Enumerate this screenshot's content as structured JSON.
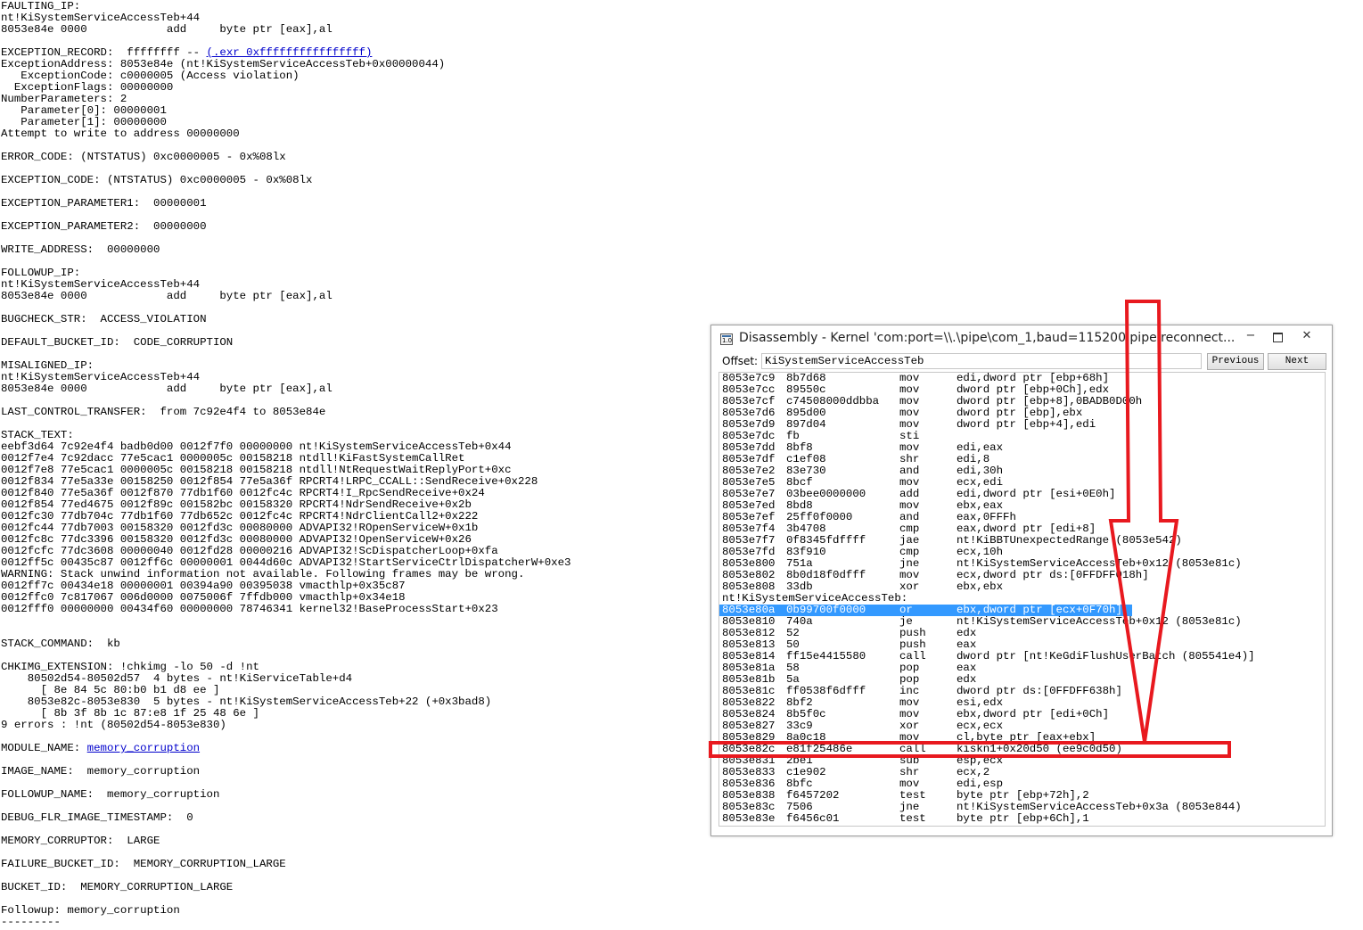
{
  "left_log": {
    "lines": [
      "FAULTING_IP:",
      "nt!KiSystemServiceAccessTeb+44",
      "8053e84e 0000            add     byte ptr [eax],al",
      "",
      "EXCEPTION_RECORD:  ffffffff -- ",
      "ExceptionAddress: 8053e84e (nt!KiSystemServiceAccessTeb+0x00000044)",
      "   ExceptionCode: c0000005 (Access violation)",
      "  ExceptionFlags: 00000000",
      "NumberParameters: 2",
      "   Parameter[0]: 00000001",
      "   Parameter[1]: 00000000",
      "Attempt to write to address 00000000",
      "",
      "ERROR_CODE: (NTSTATUS) 0xc0000005 - 0x%08lx",
      "",
      "EXCEPTION_CODE: (NTSTATUS) 0xc0000005 - 0x%08lx",
      "",
      "EXCEPTION_PARAMETER1:  00000001",
      "",
      "EXCEPTION_PARAMETER2:  00000000",
      "",
      "WRITE_ADDRESS:  00000000",
      "",
      "FOLLOWUP_IP:",
      "nt!KiSystemServiceAccessTeb+44",
      "8053e84e 0000            add     byte ptr [eax],al",
      "",
      "BUGCHECK_STR:  ACCESS_VIOLATION",
      "",
      "DEFAULT_BUCKET_ID:  CODE_CORRUPTION",
      "",
      "MISALIGNED_IP:",
      "nt!KiSystemServiceAccessTeb+44",
      "8053e84e 0000            add     byte ptr [eax],al",
      "",
      "LAST_CONTROL_TRANSFER:  from 7c92e4f4 to 8053e84e",
      "",
      "STACK_TEXT:",
      "eebf3d64 7c92e4f4 badb0d00 0012f7f0 00000000 nt!KiSystemServiceAccessTeb+0x44",
      "0012f7e4 7c92dacc 77e5cac1 0000005c 00158218 ntdll!KiFastSystemCallRet",
      "0012f7e8 77e5cac1 0000005c 00158218 00158218 ntdll!NtRequestWaitReplyPort+0xc",
      "0012f834 77e5a33e 00158250 0012f854 77e5a36f RPCRT4!LRPC_CCALL::SendReceive+0x228",
      "0012f840 77e5a36f 0012f870 77db1f60 0012fc4c RPCRT4!I_RpcSendReceive+0x24",
      "0012f854 77ed4675 0012f89c 001582bc 00158320 RPCRT4!NdrSendReceive+0x2b",
      "0012fc30 77db704c 77db1f60 77db652c 0012fc4c RPCRT4!NdrClientCall2+0x222",
      "0012fc44 77db7003 00158320 0012fd3c 00080000 ADVAPI32!ROpenServiceW+0x1b",
      "0012fc8c 77dc3396 00158320 0012fd3c 00080000 ADVAPI32!OpenServiceW+0x26",
      "0012fcfc 77dc3608 00000040 0012fd28 00000216 ADVAPI32!ScDispatcherLoop+0xfa",
      "0012ff5c 00435c87 0012ff6c 00000001 0044d60c ADVAPI32!StartServiceCtrlDispatcherW+0xe3",
      "WARNING: Stack unwind information not available. Following frames may be wrong.",
      "0012ff7c 00434e18 00000001 00394a90 00395038 vmacthlp+0x35c87",
      "0012ffc0 7c817067 006d0000 0075006f 7ffdb000 vmacthlp+0x34e18",
      "0012fff0 00000000 00434f60 00000000 78746341 kernel32!BaseProcessStart+0x23",
      "",
      "",
      "STACK_COMMAND:  kb",
      "",
      "CHKIMG_EXTENSION: !chkimg -lo 50 -d !nt",
      "    80502d54-80502d57  4 bytes - nt!KiServiceTable+d4",
      "      [ 8e 84 5c 80:b0 b1 d8 ee ]",
      "    8053e82c-8053e830  5 bytes - nt!KiSystemServiceAccessTeb+22 (+0x3bad8)",
      "      [ 8b 3f 8b 1c 87:e8 1f 25 48 6e ]",
      "9 errors : !nt (80502d54-8053e830)",
      "",
      "MODULE_NAME: ",
      "",
      "IMAGE_NAME:  memory_corruption",
      "",
      "FOLLOWUP_NAME:  memory_corruption",
      "",
      "DEBUG_FLR_IMAGE_TIMESTAMP:  0",
      "",
      "MEMORY_CORRUPTOR:  LARGE",
      "",
      "FAILURE_BUCKET_ID:  MEMORY_CORRUPTION_LARGE",
      "",
      "BUCKET_ID:  MEMORY_CORRUPTION_LARGE",
      "",
      "Followup: memory_corruption",
      "---------"
    ],
    "exr_link": "(.exr 0xffffffffffffffff)",
    "module_link": "memory_corruption"
  },
  "window": {
    "title": "Disassembly - Kernel 'com:port=\\\\.\\pipe\\com_1,baud=115200,pipe,reconnect...",
    "min_glyph": "−",
    "close_glyph": "✕",
    "offset_label": "Offset:",
    "offset_value": "KiSystemServiceAccessTeb",
    "prev_label": "Previous",
    "next_label": "Next"
  },
  "disassembly": [
    {
      "addr": "8053e7c9",
      "bytes": "8b7d68",
      "mn": "mov",
      "op": "edi,dword ptr [ebp+68h]"
    },
    {
      "addr": "8053e7cc",
      "bytes": "89550c",
      "mn": "mov",
      "op": "dword ptr [ebp+0Ch],edx"
    },
    {
      "addr": "8053e7cf",
      "bytes": "c74508000ddbba",
      "mn": "mov",
      "op": "dword ptr [ebp+8],0BADB0D00h"
    },
    {
      "addr": "8053e7d6",
      "bytes": "895d00",
      "mn": "mov",
      "op": "dword ptr [ebp],ebx"
    },
    {
      "addr": "8053e7d9",
      "bytes": "897d04",
      "mn": "mov",
      "op": "dword ptr [ebp+4],edi"
    },
    {
      "addr": "8053e7dc",
      "bytes": "fb",
      "mn": "sti",
      "op": ""
    },
    {
      "addr": "8053e7dd",
      "bytes": "8bf8",
      "mn": "mov",
      "op": "edi,eax"
    },
    {
      "addr": "8053e7df",
      "bytes": "c1ef08",
      "mn": "shr",
      "op": "edi,8"
    },
    {
      "addr": "8053e7e2",
      "bytes": "83e730",
      "mn": "and",
      "op": "edi,30h"
    },
    {
      "addr": "8053e7e5",
      "bytes": "8bcf",
      "mn": "mov",
      "op": "ecx,edi"
    },
    {
      "addr": "8053e7e7",
      "bytes": "03bee0000000",
      "mn": "add",
      "op": "edi,dword ptr [esi+0E0h]"
    },
    {
      "addr": "8053e7ed",
      "bytes": "8bd8",
      "mn": "mov",
      "op": "ebx,eax"
    },
    {
      "addr": "8053e7ef",
      "bytes": "25ff0f0000",
      "mn": "and",
      "op": "eax,0FFFh"
    },
    {
      "addr": "8053e7f4",
      "bytes": "3b4708",
      "mn": "cmp",
      "op": "eax,dword ptr [edi+8]"
    },
    {
      "addr": "8053e7f7",
      "bytes": "0f8345fdffff",
      "mn": "jae",
      "op": "nt!KiBBTUnexpectedRange (8053e542)"
    },
    {
      "addr": "8053e7fd",
      "bytes": "83f910",
      "mn": "cmp",
      "op": "ecx,10h"
    },
    {
      "addr": "8053e800",
      "bytes": "751a",
      "mn": "jne",
      "op": "nt!KiSystemServiceAccessTeb+0x12 (8053e81c)"
    },
    {
      "addr": "8053e802",
      "bytes": "8b0d18f0dfff",
      "mn": "mov",
      "op": "ecx,dword ptr ds:[0FFDFF018h]"
    },
    {
      "addr": "8053e808",
      "bytes": "33db",
      "mn": "xor",
      "op": "ebx,ebx"
    },
    {
      "label": "nt!KiSystemServiceAccessTeb:"
    },
    {
      "addr": "8053e80a",
      "bytes": "0b99700f0000",
      "mn": "or",
      "op": "ebx,dword ptr [ecx+0F70h]",
      "selected": true
    },
    {
      "addr": "8053e810",
      "bytes": "740a",
      "mn": "je",
      "op": "nt!KiSystemServiceAccessTeb+0x12 (8053e81c)"
    },
    {
      "addr": "8053e812",
      "bytes": "52",
      "mn": "push",
      "op": "edx"
    },
    {
      "addr": "8053e813",
      "bytes": "50",
      "mn": "push",
      "op": "eax"
    },
    {
      "addr": "8053e814",
      "bytes": "ff15e4415580",
      "mn": "call",
      "op": "dword ptr [nt!KeGdiFlushUserBatch (805541e4)]"
    },
    {
      "addr": "8053e81a",
      "bytes": "58",
      "mn": "pop",
      "op": "eax"
    },
    {
      "addr": "8053e81b",
      "bytes": "5a",
      "mn": "pop",
      "op": "edx"
    },
    {
      "addr": "8053e81c",
      "bytes": "ff0538f6dfff",
      "mn": "inc",
      "op": "dword ptr ds:[0FFDFF638h]"
    },
    {
      "addr": "8053e822",
      "bytes": "8bf2",
      "mn": "mov",
      "op": "esi,edx"
    },
    {
      "addr": "8053e824",
      "bytes": "8b5f0c",
      "mn": "mov",
      "op": "ebx,dword ptr [edi+0Ch]"
    },
    {
      "addr": "8053e827",
      "bytes": "33c9",
      "mn": "xor",
      "op": "ecx,ecx"
    },
    {
      "addr": "8053e829",
      "bytes": "8a0c18",
      "mn": "mov",
      "op": "cl,byte ptr [eax+ebx]"
    },
    {
      "addr": "8053e82c",
      "bytes": "e81f25486e",
      "mn": "call",
      "op": "kiskn1+0x20d50 (ee9c0d50)"
    },
    {
      "addr": "8053e831",
      "bytes": "2be1",
      "mn": "sub",
      "op": "esp,ecx"
    },
    {
      "addr": "8053e833",
      "bytes": "c1e902",
      "mn": "shr",
      "op": "ecx,2"
    },
    {
      "addr": "8053e836",
      "bytes": "8bfc",
      "mn": "mov",
      "op": "edi,esp"
    },
    {
      "addr": "8053e838",
      "bytes": "f6457202",
      "mn": "test",
      "op": "byte ptr [ebp+72h],2"
    },
    {
      "addr": "8053e83c",
      "bytes": "7506",
      "mn": "jne",
      "op": "nt!KiSystemServiceAccessTeb+0x3a (8053e844)"
    },
    {
      "addr": "8053e83e",
      "bytes": "f6456c01",
      "mn": "test",
      "op": "byte ptr [ebp+6Ch],1"
    }
  ],
  "annotation": {
    "color": "#e8191f",
    "highlight_row_address": "8053e82c"
  }
}
